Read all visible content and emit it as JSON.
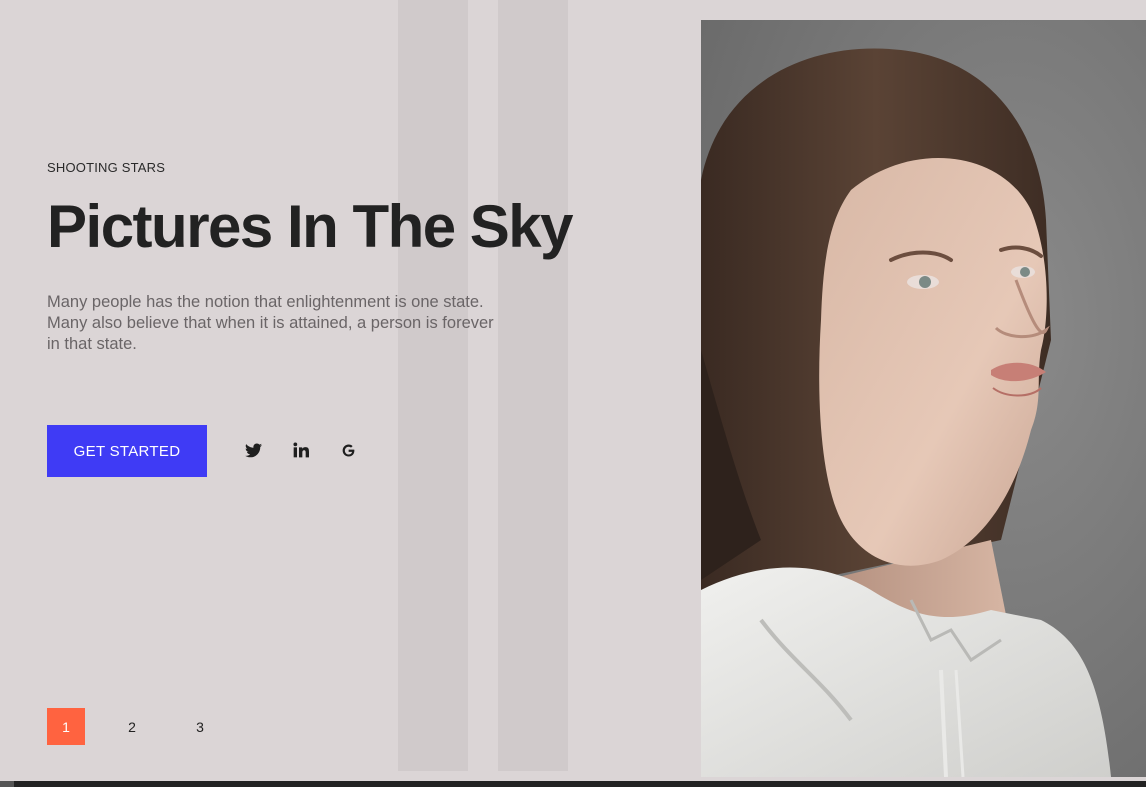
{
  "hero": {
    "eyebrow": "SHOOTING STARS",
    "title": "Pictures In The Sky",
    "description": "Many people has the notion that enlightenment is one state. Many also believe that when it is attained, a person is forever in that state.",
    "cta_label": "GET STARTED"
  },
  "social": {
    "icons": [
      "twitter-icon",
      "linkedin-icon",
      "google-icon"
    ]
  },
  "pagination": {
    "pages": [
      "1",
      "2",
      "3"
    ],
    "active": "1"
  },
  "colors": {
    "background": "#dbd5d6",
    "stripe": "#d0cacb",
    "cta": "#3f3bf5",
    "pagination_active": "#ff6340",
    "title": "#222222",
    "body_text": "#6a6567"
  },
  "image": {
    "subject": "portrait-photo"
  }
}
